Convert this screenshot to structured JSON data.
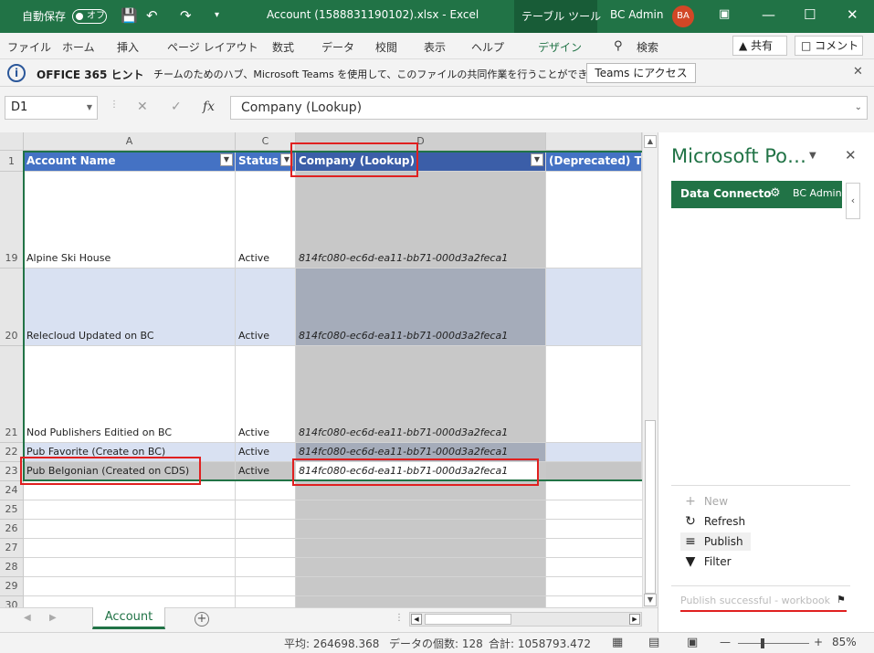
{
  "titlebar": {
    "autosave_label": "自動保存",
    "autosave_state": "オフ",
    "file_title": "Account (1588831190102).xlsx  -  Excel",
    "context_tab": "テーブル ツール",
    "user_name": "BC Admin",
    "user_initials": "BA"
  },
  "ribbon": {
    "tabs": [
      "ファイル",
      "ホーム",
      "挿入",
      "ページ レイアウト",
      "数式",
      "データ",
      "校閲",
      "表示",
      "ヘルプ",
      "デザイン"
    ],
    "search_label": "検索",
    "share_label": "共有",
    "comment_label": "コメント"
  },
  "infobar": {
    "title": "OFFICE 365 ヒント",
    "message": "チームのためのハブ、Microsoft Teams を使用して、このファイルの共同作業を行うことができます。",
    "button_label": "Teams にアクセス"
  },
  "formula": {
    "name_box": "D1",
    "fx_label": "fx",
    "content": "Company (Lookup)"
  },
  "grid": {
    "col_letters": [
      "A",
      "C",
      "D"
    ],
    "headers": [
      "Account Name",
      "Status",
      "Company (Lookup)",
      "(Deprecated) Tra"
    ],
    "rows": [
      {
        "num": "19",
        "name": "Alpine Ski House",
        "status": "Active",
        "company": "814fc080-ec6d-ea11-bb71-000d3a2feca1"
      },
      {
        "num": "20",
        "name": "Relecloud Updated on BC",
        "status": "Active",
        "company": "814fc080-ec6d-ea11-bb71-000d3a2feca1"
      },
      {
        "num": "21",
        "name": "Nod Publishers Editied on BC",
        "status": "Active",
        "company": "814fc080-ec6d-ea11-bb71-000d3a2feca1"
      },
      {
        "num": "22",
        "name": "Pub Favorite (Create on BC)",
        "status": "Active",
        "company": "814fc080-ec6d-ea11-bb71-000d3a2feca1"
      },
      {
        "num": "23",
        "name": "Pub Belgonian (Created on CDS)",
        "status": "Active",
        "company": "814fc080-ec6d-ea11-bb71-000d3a2feca1"
      }
    ],
    "empty_rows": [
      "24",
      "25",
      "26",
      "27",
      "28",
      "29",
      "30"
    ]
  },
  "sheets": {
    "active_tab": "Account"
  },
  "pane": {
    "title": "Microsoft Po…",
    "connector_label": "Data Connecto",
    "connector_user": "BC Admin",
    "actions": [
      "New",
      "Refresh",
      "Publish",
      "Filter"
    ],
    "status_message": "Publish successful - workbook"
  },
  "statusbar": {
    "average": "平均: 264698.368",
    "count": "データの個数: 128",
    "sum": "合計: 1058793.472",
    "zoom": "85%"
  }
}
